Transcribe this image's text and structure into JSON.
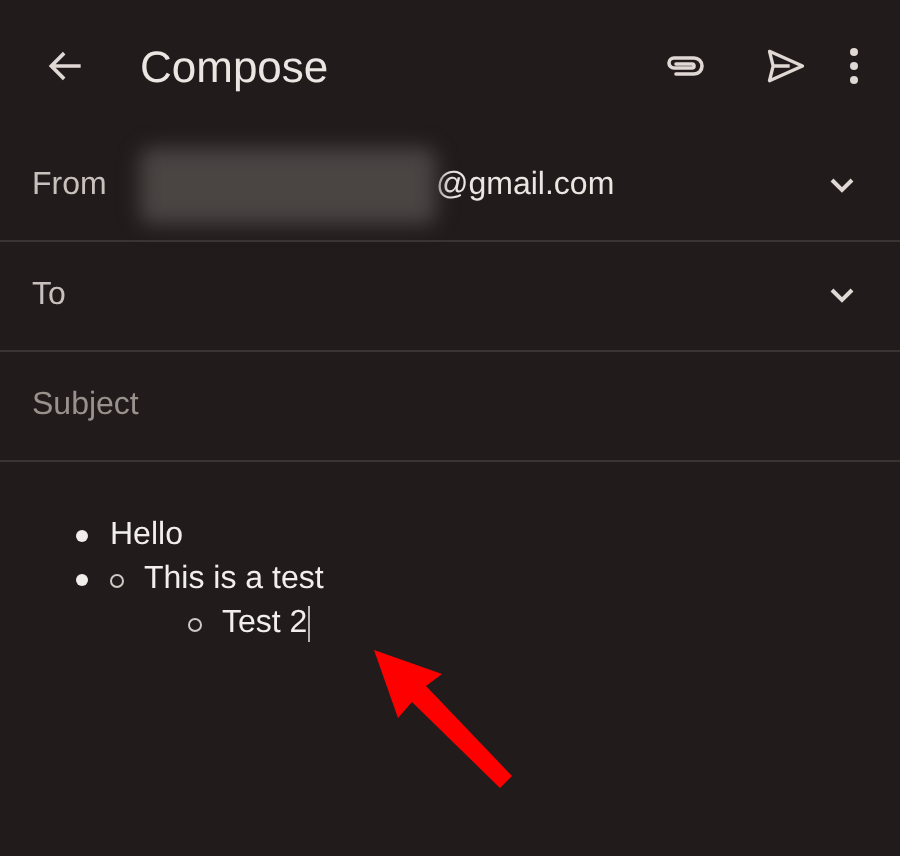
{
  "app_bar": {
    "title": "Compose"
  },
  "fields": [
    {
      "kind": "address",
      "label": "From",
      "redacted": true,
      "value": "@gmail.com",
      "expandable": true
    },
    {
      "kind": "address",
      "label": "To",
      "expandable": true
    },
    {
      "kind": "subject",
      "placeholder": "Subject"
    }
  ],
  "body": {
    "items": [
      {
        "text": "Hello"
      },
      {
        "children": [
          {
            "text": "This is a test",
            "cursor": false
          },
          {
            "text": "Test 2",
            "cursor": true
          }
        ]
      }
    ]
  },
  "annotation": {
    "kind": "arrow"
  }
}
